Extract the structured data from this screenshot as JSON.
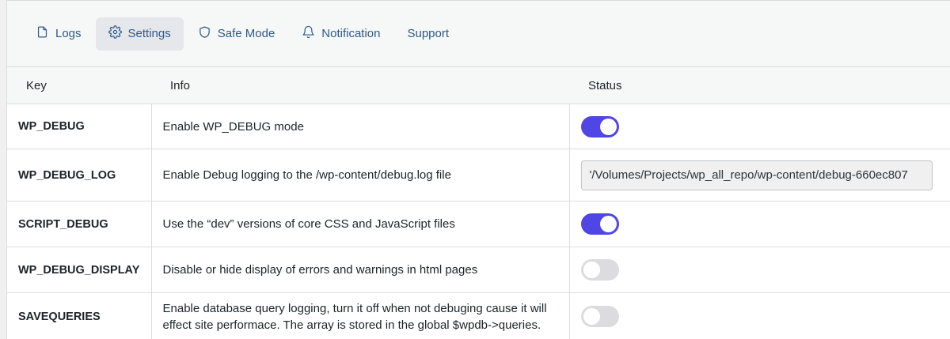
{
  "tabs": [
    {
      "label": "Logs",
      "icon": "file-icon",
      "active": false
    },
    {
      "label": "Settings",
      "icon": "gear-icon",
      "active": true
    },
    {
      "label": "Safe Mode",
      "icon": "shield-icon",
      "active": false
    },
    {
      "label": "Notification",
      "icon": "bell-icon",
      "active": false
    },
    {
      "label": "Support",
      "icon": "",
      "active": false
    }
  ],
  "table": {
    "headers": {
      "key": "Key",
      "info": "Info",
      "status": "Status"
    },
    "rows": [
      {
        "key": "WP_DEBUG",
        "info": "Enable WP_DEBUG mode",
        "status_type": "toggle",
        "enabled": true
      },
      {
        "key": "WP_DEBUG_LOG",
        "info": "Enable Debug logging to the /wp-content/debug.log file",
        "status_type": "input",
        "value": "'/Volumes/Projects/wp_all_repo/wp-content/debug-660ec807"
      },
      {
        "key": "SCRIPT_DEBUG",
        "info": "Use the “dev” versions of core CSS and JavaScript files",
        "status_type": "toggle",
        "enabled": true
      },
      {
        "key": "WP_DEBUG_DISPLAY",
        "info": "Disable or hide display of errors and warnings in html pages",
        "status_type": "toggle",
        "enabled": false
      },
      {
        "key": "SAVEQUERIES",
        "info": "Enable database query logging, turn it off when not debuging cause it will effect site performace. The array is stored in the global $wpdb->queries.",
        "status_type": "toggle",
        "enabled": false
      }
    ]
  },
  "colors": {
    "toggle_on": "#4f46e5",
    "toggle_off": "#dcdcde",
    "tab_text": "#2c5a8c",
    "tab_active_bg": "#e6e7ea"
  }
}
